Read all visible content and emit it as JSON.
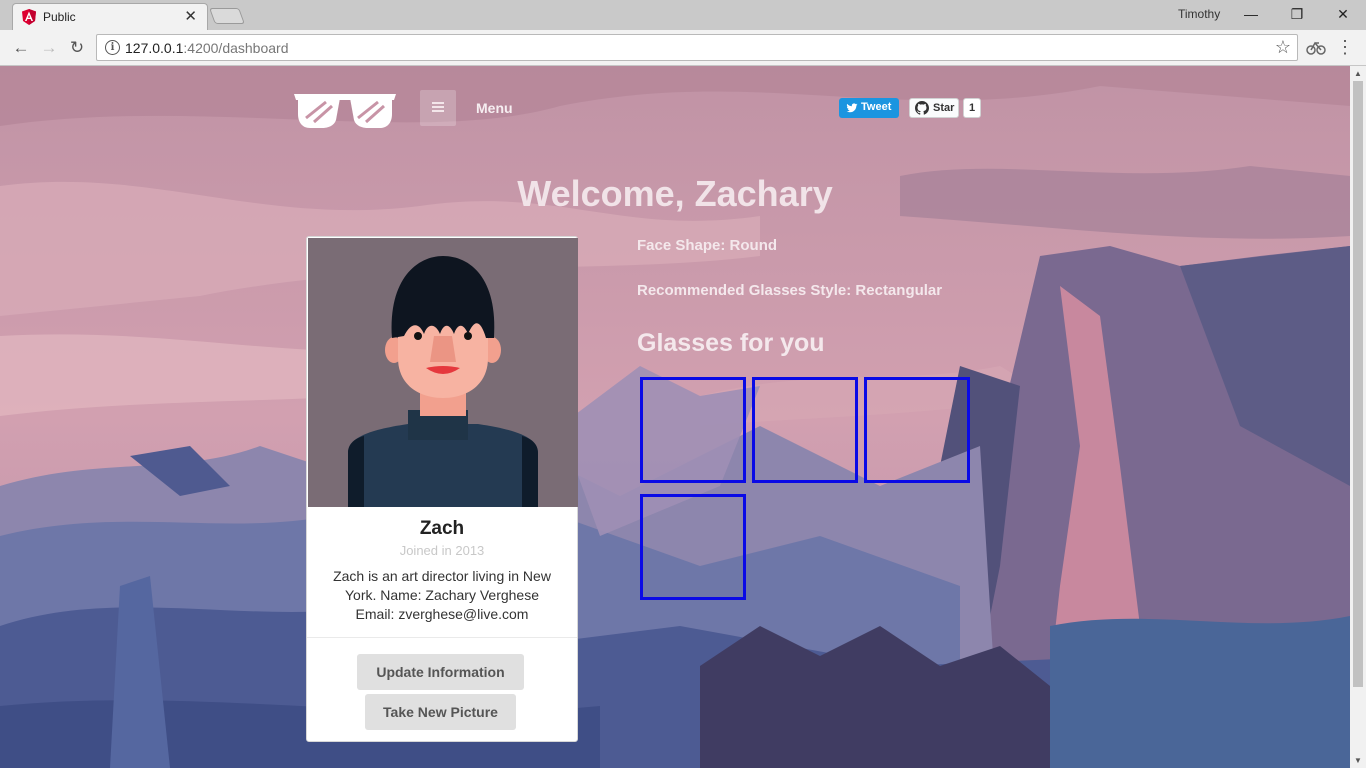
{
  "browser": {
    "tab_title": "Public",
    "tab_close": "✕",
    "user": "Timothy",
    "url_host": "127.0.0.1",
    "url_path": ":4200/dashboard",
    "window_controls": {
      "minimize": "—",
      "restore": "❐",
      "close": "✕"
    },
    "nav": {
      "back": "←",
      "forward": "→",
      "reload": "↻"
    },
    "info": "i",
    "star": "☆",
    "menu": "⋮"
  },
  "navbar": {
    "menu_label": "Menu",
    "tweet_label": "Tweet",
    "star_label": "Star",
    "star_count": "1"
  },
  "page": {
    "welcome": "Welcome, Zachary",
    "face_shape": "Face Shape: Round",
    "recommended_style": "Recommended Glasses Style: Rectangular",
    "glasses_heading": "Glasses for you",
    "glasses_slots": 4
  },
  "card": {
    "name": "Zach",
    "joined": "Joined in 2013",
    "description": "Zach is an art director living in New York. Name: Zachary Verghese Email: zverghese@live.com",
    "update_button": "Update Information",
    "picture_button": "Take New Picture"
  },
  "colors": {
    "accent_box": "#0a0ae6",
    "tweet_blue": "#1b95e0"
  }
}
